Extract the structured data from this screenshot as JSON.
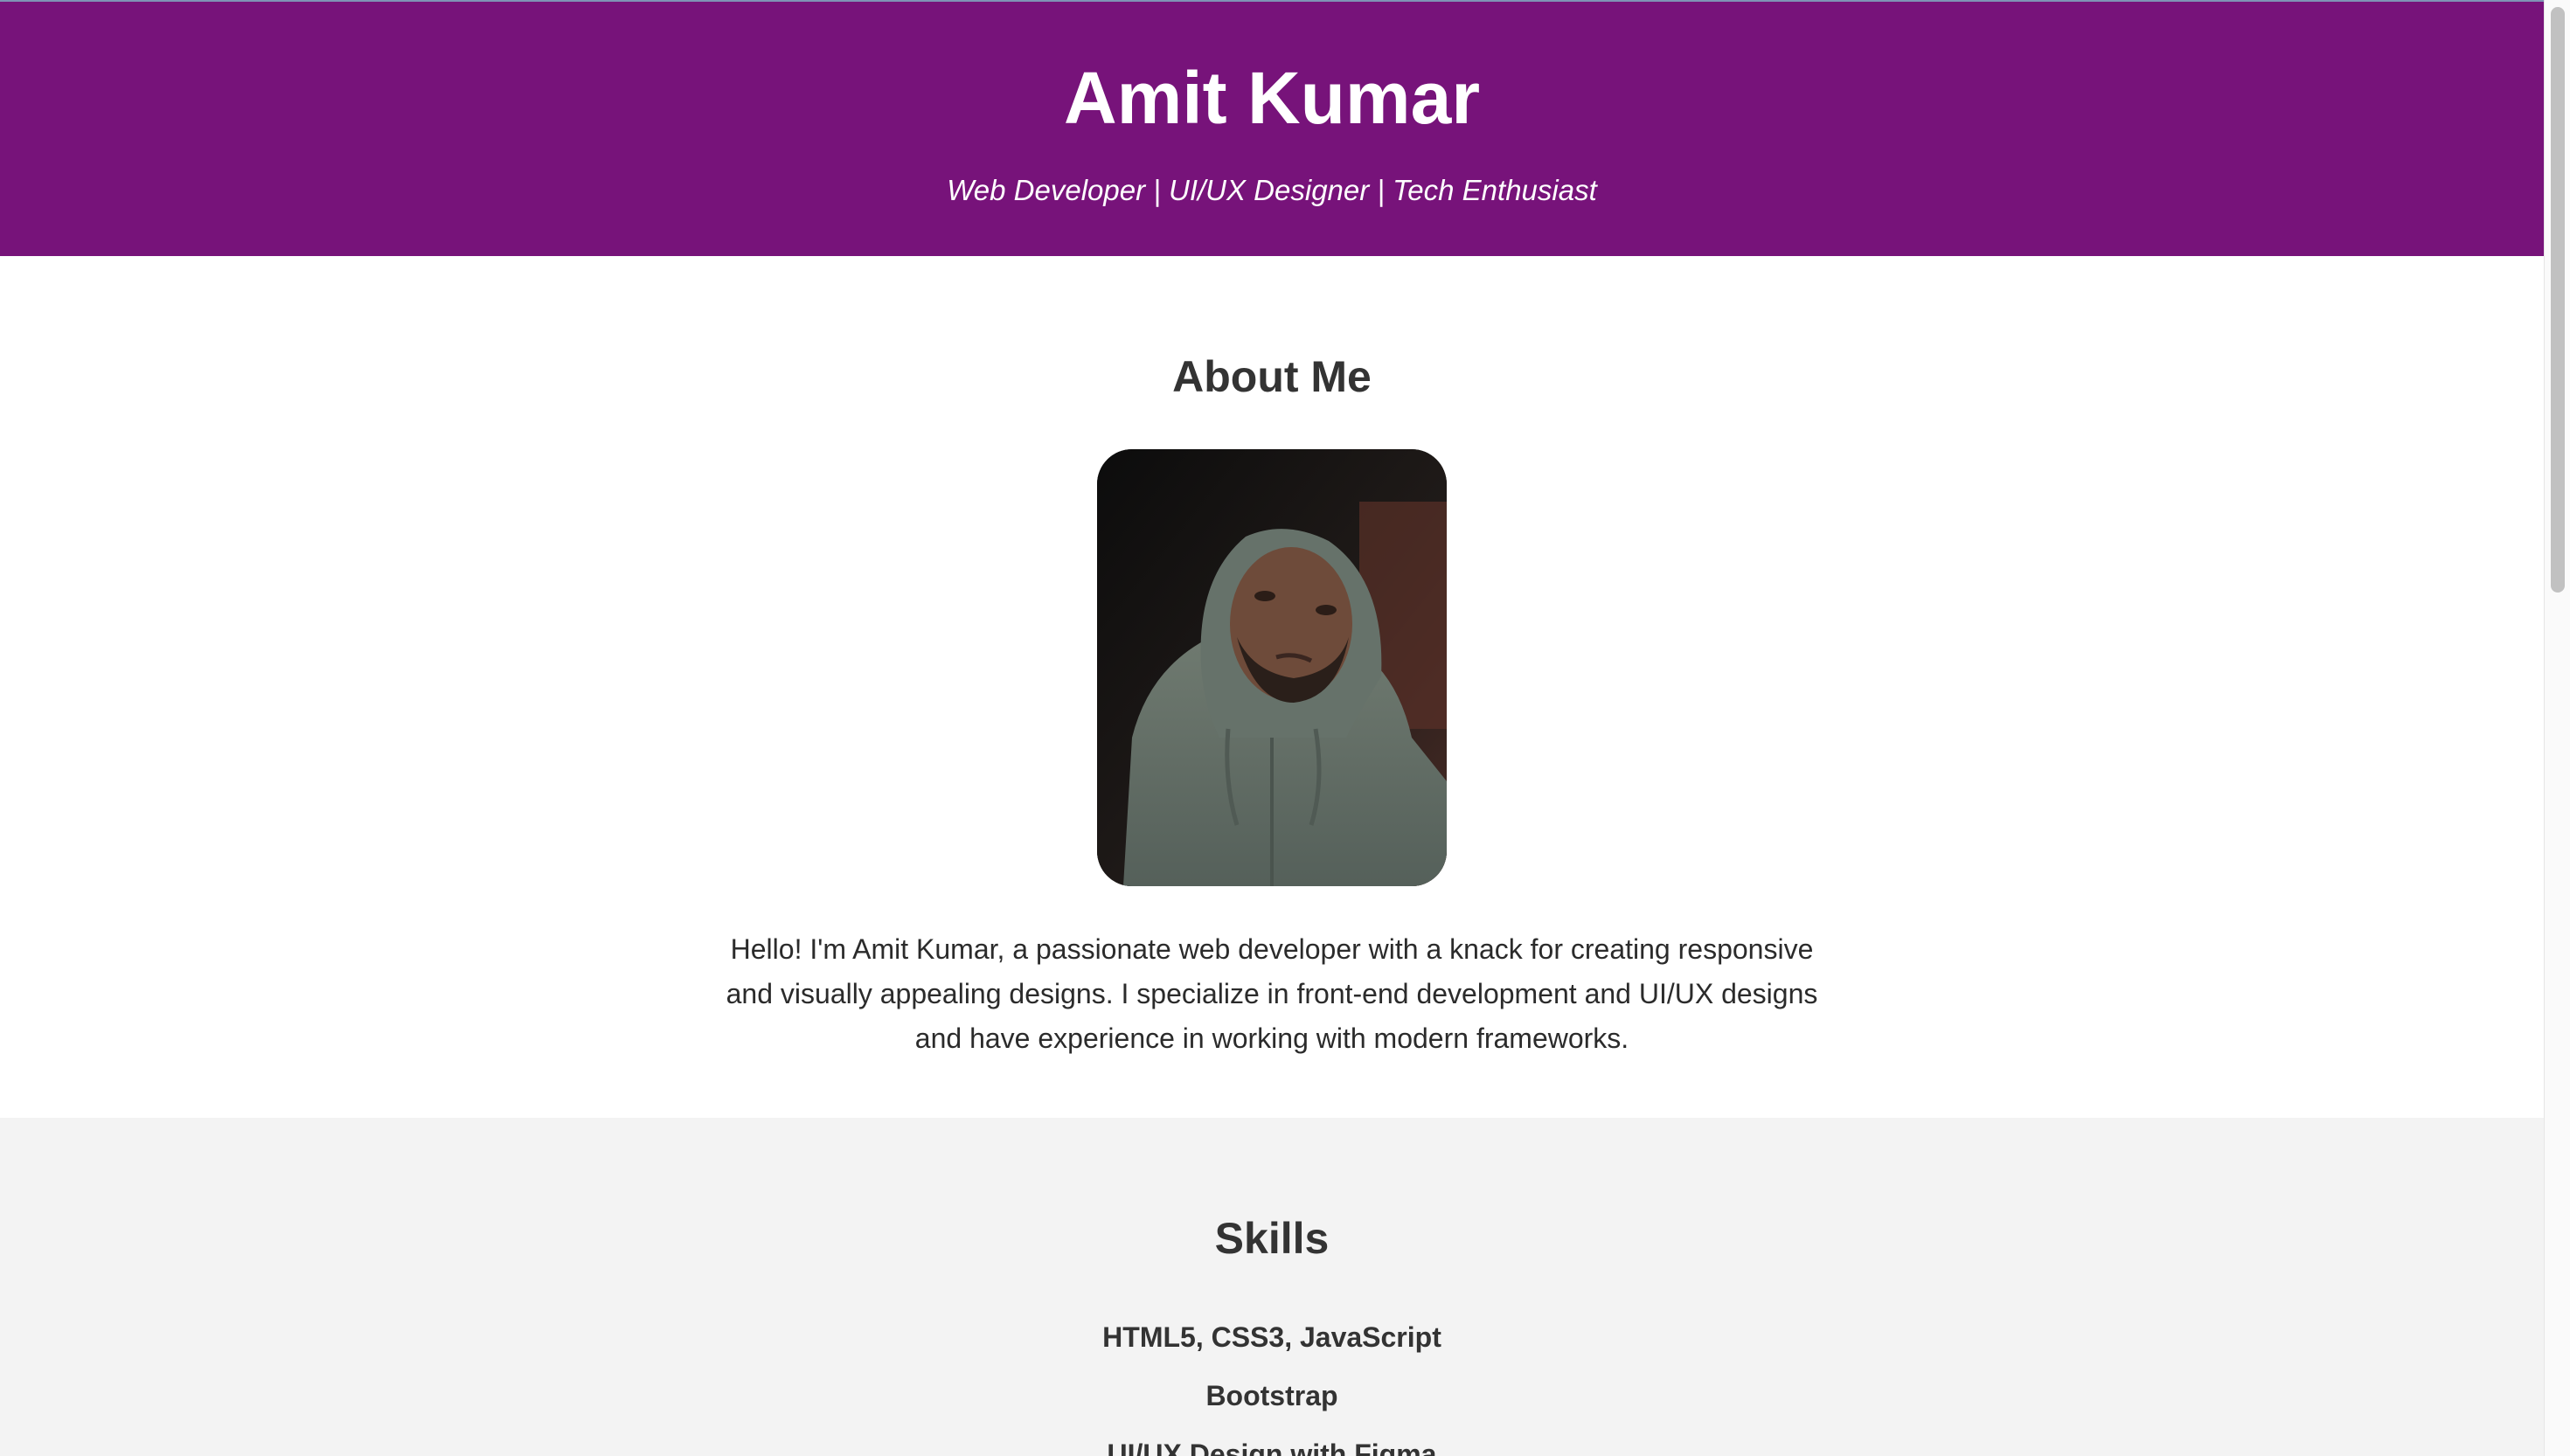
{
  "header": {
    "name": "Amit Kumar",
    "tagline": "Web Developer | UI/UX Designer | Tech Enthusiast"
  },
  "about": {
    "heading": "About Me",
    "photo_icon": "profile-photo",
    "text": "Hello! I'm Amit Kumar, a passionate web developer with a knack for creating responsive and visually appealing designs. I specialize in front-end development and UI/UX designs and have experience in working with modern frameworks."
  },
  "skills": {
    "heading": "Skills",
    "items": [
      "HTML5, CSS3, JavaScript",
      "Bootstrap",
      "UI/UX Design with Figma"
    ]
  },
  "colors": {
    "header_bg": "#77137a",
    "skills_bg": "#f3f3f3",
    "text": "#333333"
  }
}
